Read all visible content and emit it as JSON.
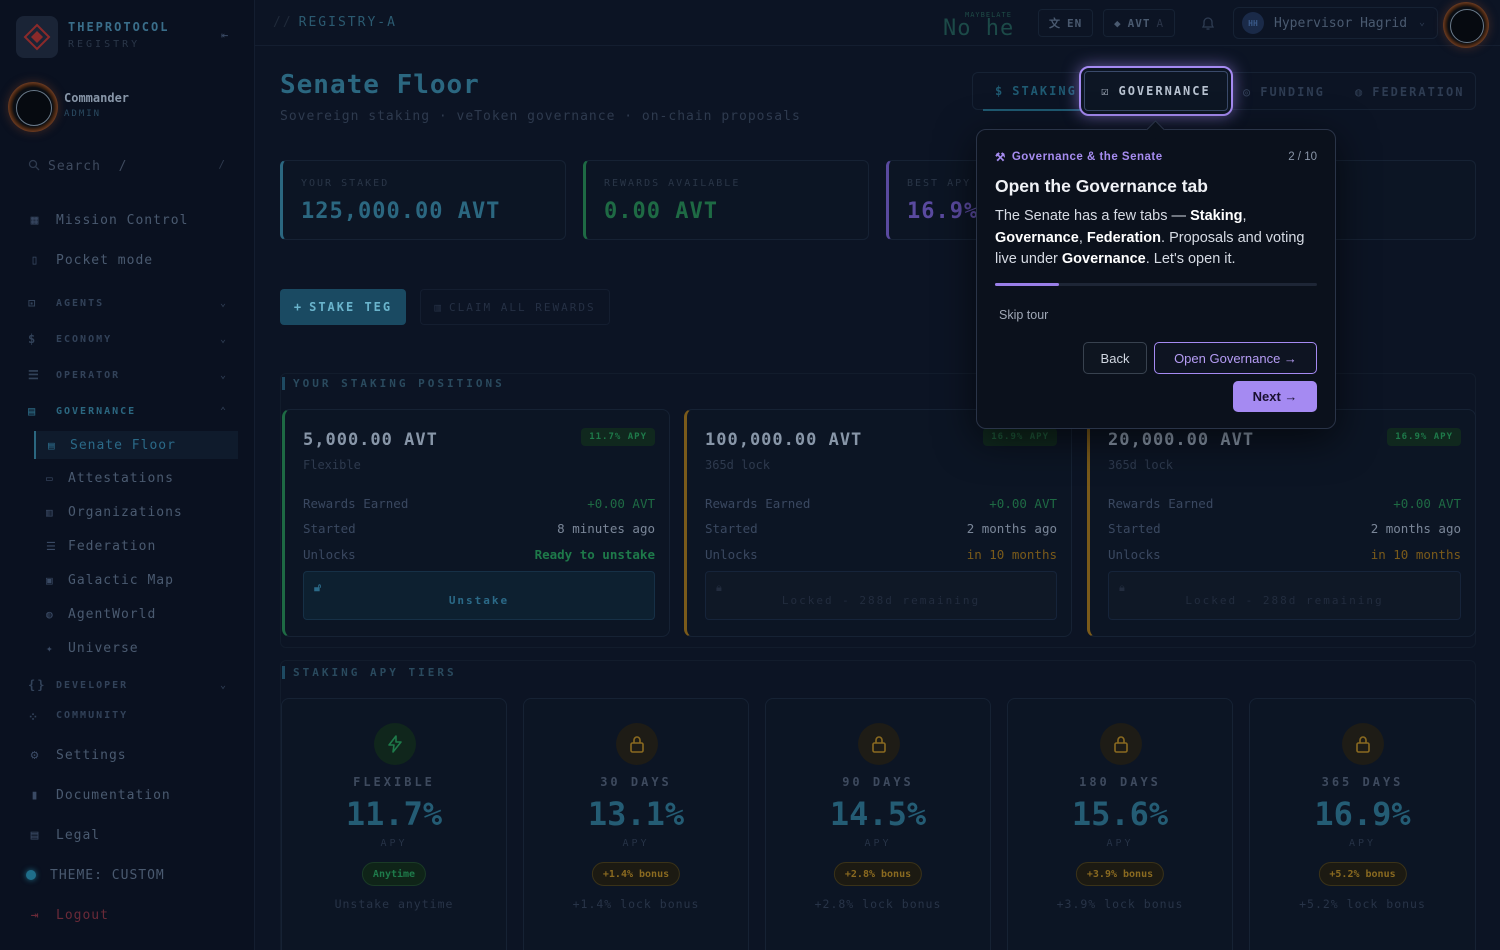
{
  "brand": {
    "name": "THEPROTOCOL",
    "sub": "REGISTRY"
  },
  "user": {
    "name": "Commander",
    "role": "ADMIN"
  },
  "search": {
    "placeholder": "Search  /",
    "shortcut": "/"
  },
  "nav": {
    "top": [
      {
        "label": "Mission Control",
        "icon": "grid-icon"
      },
      {
        "label": "Pocket mode",
        "icon": "phone-icon"
      }
    ],
    "sections": [
      {
        "label": "AGENTS",
        "icon": "robot-icon"
      },
      {
        "label": "ECONOMY",
        "icon": "dollar-icon"
      },
      {
        "label": "OPERATOR",
        "icon": "server-icon"
      },
      {
        "label": "GOVERNANCE",
        "icon": "building-icon"
      },
      {
        "label": "DEVELOPER",
        "icon": "braces-icon"
      },
      {
        "label": "COMMUNITY",
        "icon": "people-icon"
      }
    ],
    "governance_items": [
      {
        "label": "Senate Floor",
        "icon": "building-icon"
      },
      {
        "label": "Attestations",
        "icon": "message-icon"
      },
      {
        "label": "Organizations",
        "icon": "office-icon"
      },
      {
        "label": "Federation",
        "icon": "server-icon"
      },
      {
        "label": "Galactic Map",
        "icon": "map-icon"
      },
      {
        "label": "AgentWorld",
        "icon": "globe-icon"
      },
      {
        "label": "Universe",
        "icon": "sparkle-icon"
      }
    ],
    "bottom": [
      {
        "label": "Settings",
        "icon": "gear-icon"
      },
      {
        "label": "Documentation",
        "icon": "book-icon"
      },
      {
        "label": "Legal",
        "icon": "scale-icon"
      },
      {
        "label": "THEME: CUSTOM",
        "icon": "theme-dot-icon"
      },
      {
        "label": "Logout",
        "icon": "logout-icon"
      }
    ]
  },
  "topbar": {
    "breadcrumb_prefix": "//",
    "breadcrumb": "REGISTRY-A",
    "clock_sub": "MAYBELATE",
    "clock": "No he",
    "lang": "EN",
    "token": "AVT",
    "token_dim": "A",
    "hypervisor_badge": "HH",
    "hypervisor": "Hypervisor Hagrid"
  },
  "page": {
    "title": "Senate Floor",
    "subtitle": "Sovereign staking · veToken governance · on-chain proposals"
  },
  "tabs": [
    {
      "label": "STAKING",
      "icon": "dollar-icon"
    },
    {
      "label": "GOVERNANCE",
      "icon": "checkbox-icon"
    },
    {
      "label": "FUNDING",
      "icon": "coin-icon"
    },
    {
      "label": "FEDERATION",
      "icon": "globe-icon"
    }
  ],
  "stats": [
    {
      "label": "YOUR STAKED",
      "value": "125,000.00 AVT",
      "color": "#2b6780"
    },
    {
      "label": "REWARDS AVAILABLE",
      "value": "0.00 AVT",
      "color": "#1e6a44"
    },
    {
      "label": "BEST APY",
      "value": "16.9%",
      "color": "#5a4aa0"
    }
  ],
  "actions": {
    "stake": "STAKE TEG",
    "claim": "CLAIM ALL REWARDS"
  },
  "positions_header": "YOUR STAKING POSITIONS",
  "positions": [
    {
      "amount": "5,000.00 AVT",
      "term": "Flexible",
      "apy": "11.7% APY",
      "rewards_label": "Rewards Earned",
      "rewards": "+0.00 AVT",
      "started_label": "Started",
      "started": "8 minutes ago",
      "unlocks_label": "Unlocks",
      "unlocks": "Ready to unstake",
      "action": "Unstake"
    },
    {
      "amount": "100,000.00 AVT",
      "term": "365d lock",
      "apy": "16.9% APY",
      "rewards_label": "Rewards Earned",
      "rewards": "+0.00 AVT",
      "started_label": "Started",
      "started": "2 months ago",
      "unlocks_label": "Unlocks",
      "unlocks": "in 10 months",
      "action": "Locked - 288d remaining"
    },
    {
      "amount": "20,000.00 AVT",
      "term": "365d lock",
      "apy": "16.9% APY",
      "rewards_label": "Rewards Earned",
      "rewards": "+0.00 AVT",
      "started_label": "Started",
      "started": "2 months ago",
      "unlocks_label": "Unlocks",
      "unlocks": "in 10 months",
      "action": "Locked - 288d remaining"
    }
  ],
  "tiers_header": "STAKING APY TIERS",
  "tiers": [
    {
      "name": "FLEXIBLE",
      "apy": "11.7%",
      "apy_label": "APY",
      "badge": "Anytime",
      "desc": "Unstake anytime",
      "icon": "bolt-icon"
    },
    {
      "name": "30 DAYS",
      "apy": "13.1%",
      "apy_label": "APY",
      "badge": "+1.4% bonus",
      "desc": "+1.4% lock bonus",
      "icon": "lock-icon"
    },
    {
      "name": "90 DAYS",
      "apy": "14.5%",
      "apy_label": "APY",
      "badge": "+2.8% bonus",
      "desc": "+2.8% lock bonus",
      "icon": "lock-icon"
    },
    {
      "name": "180 DAYS",
      "apy": "15.6%",
      "apy_label": "APY",
      "badge": "+3.9% bonus",
      "desc": "+3.9% lock bonus",
      "icon": "lock-icon"
    },
    {
      "name": "365 DAYS",
      "apy": "16.9%",
      "apy_label": "APY",
      "badge": "+5.2% bonus",
      "desc": "+5.2% lock bonus",
      "icon": "lock-icon"
    }
  ],
  "tour": {
    "kicker": "Governance & the Senate",
    "step": "2 / 10",
    "progress": 0.2,
    "title": "Open the Governance tab",
    "body_1": "The Senate has a few tabs — ",
    "staking": "Staking",
    "comma": ",",
    "governance": "Governance",
    "federation": "Federation",
    "body_2": ". Proposals and voting live under ",
    "governance_2": "Governance",
    "body_3": ". Let's open it.",
    "skip": "Skip tour",
    "back": "Back",
    "open": "Open Governance →",
    "next": "Next →"
  },
  "colors": {
    "accent": "#2b6780",
    "tour_accent": "#a58af2",
    "green": "#1e6a44",
    "gold": "#7a5a1a"
  }
}
